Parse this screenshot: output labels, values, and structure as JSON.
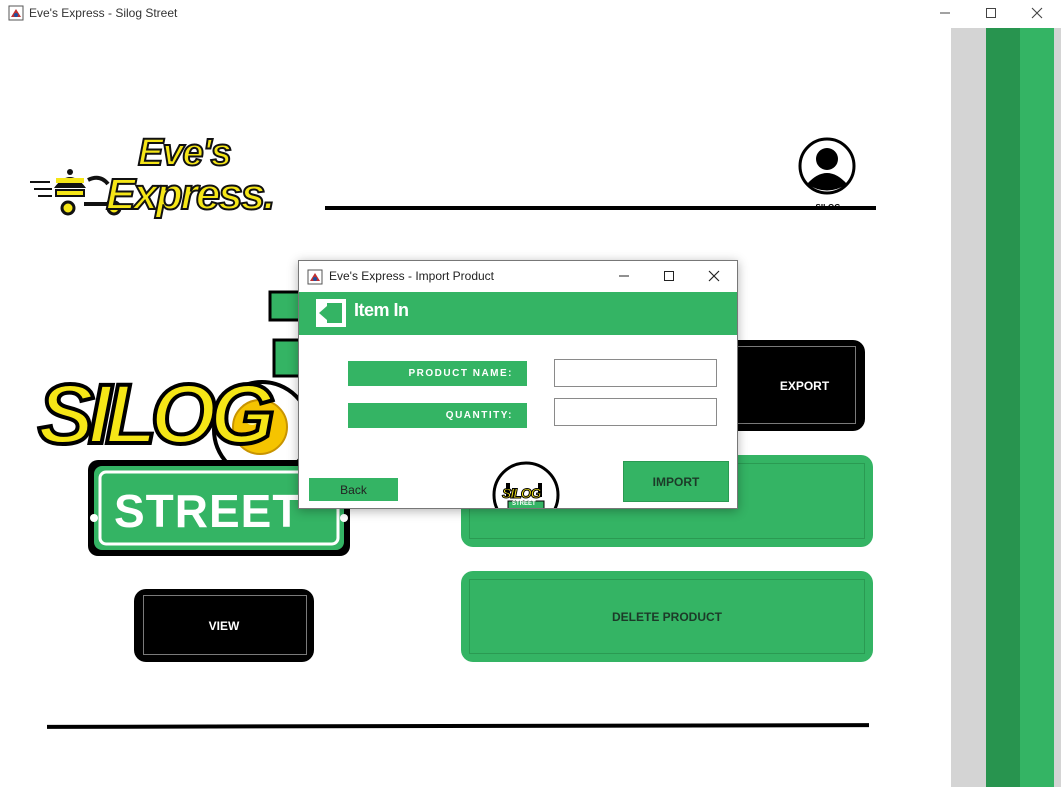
{
  "window": {
    "title": "Eve's Express - Silog Street",
    "controls": [
      "minimize-icon",
      "maximize-icon",
      "close-icon"
    ]
  },
  "header": {
    "logo_text": "Eve's Express.",
    "logo_line1": "Eve's",
    "logo_line2": "Express.",
    "user_label": "SILOG"
  },
  "brand": {
    "logo_text_top": "SILOG",
    "logo_text_bottom": "STREET"
  },
  "buttons": {
    "view": "VIEW",
    "export": "EXPORT",
    "delete_product": "DELETE PRODUCT"
  },
  "dialog": {
    "title": "Eve's Express - Import Product",
    "header_title": "Item In",
    "product_name_label": "PRODUCT NAME:",
    "quantity_label": "QUANTITY:",
    "product_name_value": "",
    "quantity_value": "",
    "back_label": "Back",
    "import_label": "IMPORT",
    "footer_logo_top": "SILOG",
    "footer_logo_bottom": "STREET"
  },
  "colors": {
    "accent_green": "#34b464",
    "dark_green": "#28944f",
    "logo_yellow": "#f5e617",
    "stripe_gray": "#d4d4d4"
  }
}
